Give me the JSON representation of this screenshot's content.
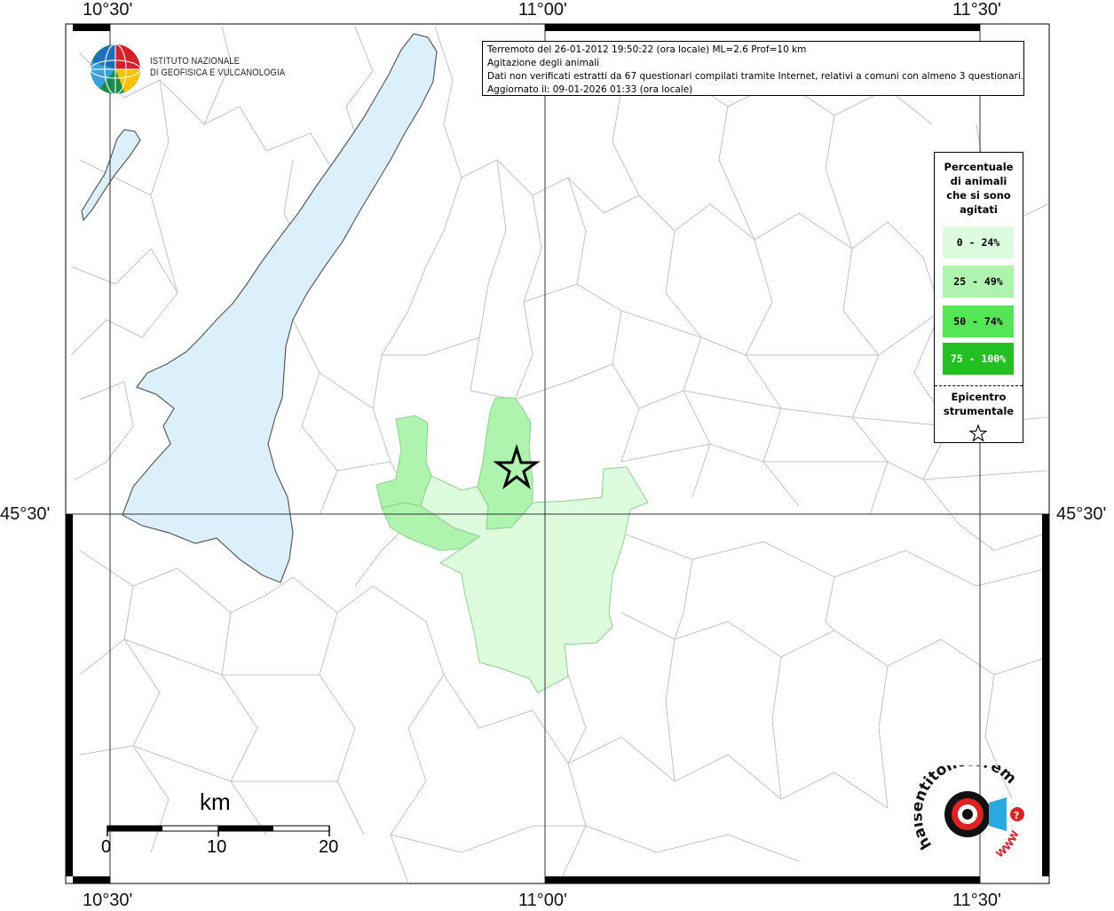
{
  "info": {
    "line1": "Terremoto del 26-01-2012 19:50:22 (ora locale) ML=2.6 Prof=10 km",
    "line2": "Agitazione degli animali",
    "line3": "Dati non verificati estratti da 67 questionari compilati tramite Internet, relativi a comuni con almeno 3 questionari.",
    "line4": "Aggiornato il: 09-01-2026 01:33 (ora locale)"
  },
  "coords": {
    "lon_left": "10°30'",
    "lon_mid": "11°00'",
    "lon_right": "11°30'",
    "lat_mid": "45°30'"
  },
  "legend": {
    "title_lines": [
      "Percentuale",
      "di animali",
      "che si sono",
      "agitati"
    ],
    "items": [
      {
        "label": "0 - 24%",
        "color": "#ddfcdd"
      },
      {
        "label": "25 - 49%",
        "color": "#aef4ae"
      },
      {
        "label": "50 - 74%",
        "color": "#55e655"
      },
      {
        "label": "75 - 100%",
        "color": "#22c022"
      }
    ],
    "epicenter_lines": [
      "Epicentro",
      "strumentale"
    ]
  },
  "logos": {
    "ingv_line1": "ISTITUTO NAZIONALE",
    "ingv_line2": "DI GEOFISICA E VULCANOLOGIA",
    "hst_text": "haisentitoilterremoto.it",
    "hst_www": "WWW"
  },
  "scale": {
    "unit": "km",
    "ticks": [
      "0",
      "10",
      "20"
    ]
  },
  "colors": {
    "lake": "#dcf0fc",
    "border": "#c2c2c2",
    "grid": "#333333"
  }
}
